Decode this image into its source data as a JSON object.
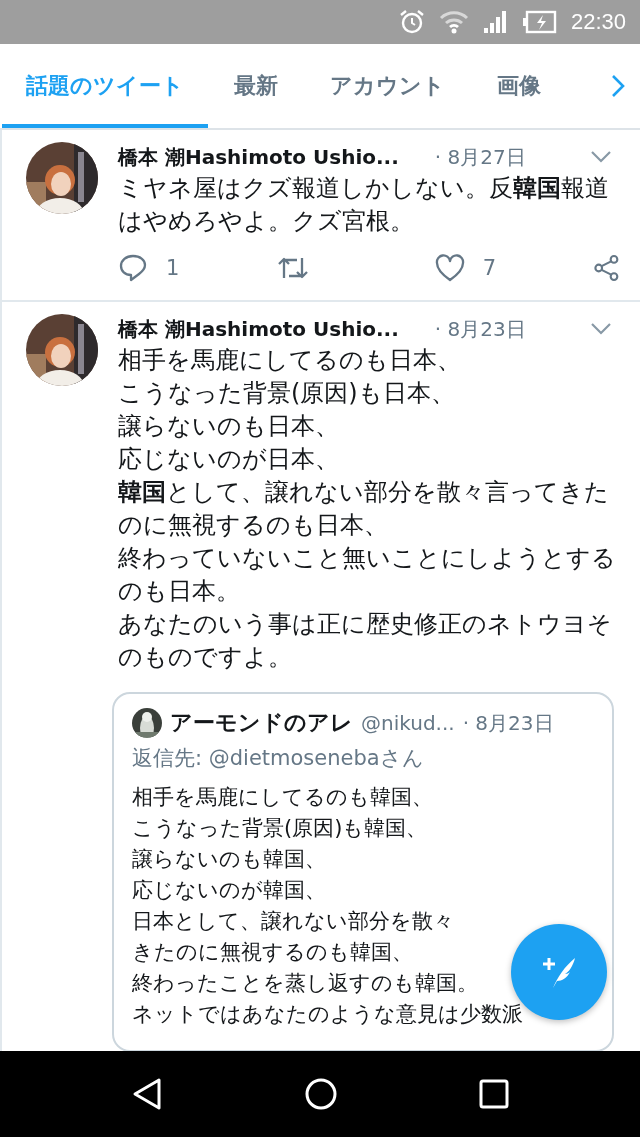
{
  "status_bar": {
    "time": "22:30"
  },
  "tabs": [
    {
      "label": "話題のツイート",
      "selected": true
    },
    {
      "label": "最新",
      "selected": false
    },
    {
      "label": "アカウント",
      "selected": false
    },
    {
      "label": "画像",
      "selected": false
    }
  ],
  "tweets": [
    {
      "author": "橋本 潮Hashimoto Ushio...",
      "date": "· 8月27日",
      "text_lines": [
        "ミヤネ屋はクズ報道しかしない。反**韓国**報道",
        "はやめろやよ。クズ宮根。"
      ],
      "actions": {
        "replies": "1",
        "likes": "7"
      }
    },
    {
      "author": "橋本 潮Hashimoto Ushio...",
      "date": "· 8月23日",
      "text_lines": [
        "相手を馬鹿にしてるのも日本、",
        "こうなった背景(原因)も日本、",
        "譲らないのも日本、",
        "応じないのが日本、",
        "**韓国**として、譲れない部分を散々言ってきた",
        "のに無視するのも日本、",
        "終わっていないこと無いことにしようとする",
        "のも日本。",
        "あなたのいう事は正に歴史修正のネトウヨそ",
        "のものですよ。"
      ],
      "quote": {
        "author": "アーモンドのアレ",
        "handle": "@nikud...",
        "date": "· 8月23日",
        "reply_to": "返信先: @dietmosenebaさん",
        "text_lines": [
          "相手を馬鹿にしてるのも韓国、",
          "こうなった背景(原因)も韓国、",
          "譲らないのも韓国、",
          "応じないのが韓国、",
          "日本として、譲れない部分を散々",
          "きたのに無視するのも韓国、",
          "終わったことを蒸し返すのも韓国。",
          "ネットではあなたのような意見は少数派"
        ]
      }
    }
  ]
}
